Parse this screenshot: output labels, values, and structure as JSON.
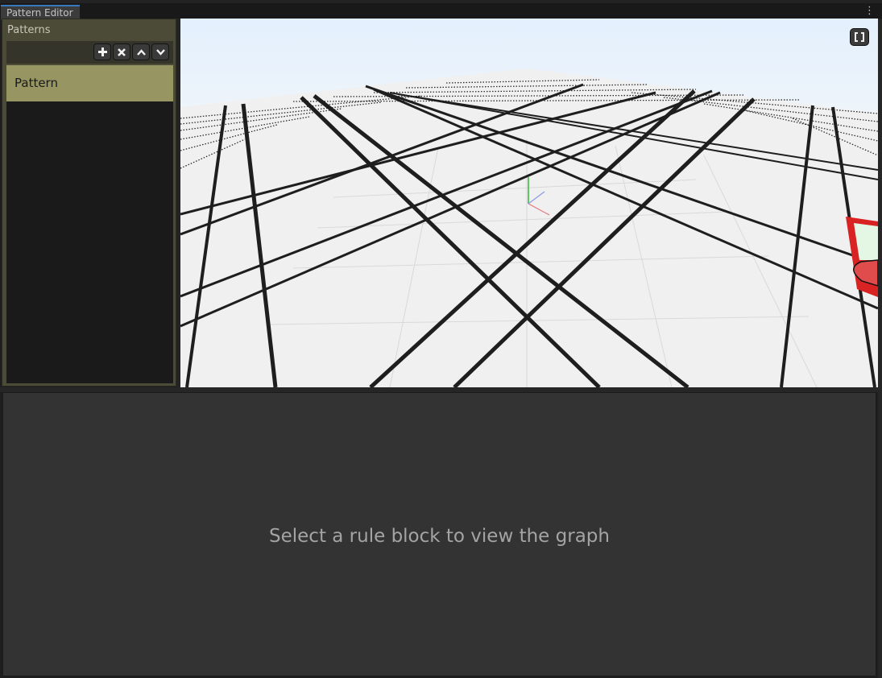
{
  "window": {
    "tab_title": "Pattern Editor",
    "menu_icon": "kebab-menu-icon"
  },
  "patterns_panel": {
    "title": "Patterns",
    "toolbar": {
      "add_icon": "plus-icon",
      "remove_icon": "close-icon",
      "move_up_icon": "chevron-up-icon",
      "move_down_icon": "chevron-down-icon"
    },
    "items": [
      {
        "label": "Pattern",
        "selected": true
      }
    ]
  },
  "viewport": {
    "frame_icon": "frame-selection-icon",
    "sky_color": "#e8f3ff",
    "ground_color": "#f0f0f0",
    "line_color": "#1e1e1e",
    "accent_object_color": "#e02424"
  },
  "graph": {
    "empty_message": "Select a rule block to view the graph"
  }
}
